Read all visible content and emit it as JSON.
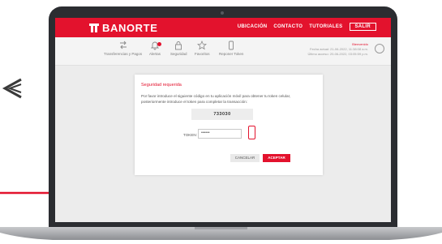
{
  "brand": {
    "name": "BANORTE",
    "color": "#e3122d"
  },
  "nav": {
    "items": [
      "UBICACIÓN",
      "CONTACTO",
      "TUTORIALES"
    ],
    "logout": "SALIR"
  },
  "toolbar": {
    "items": [
      {
        "label": "Transferencias y Pagos",
        "icon": "transfer-icon"
      },
      {
        "label": "Alertas",
        "icon": "bell-icon"
      },
      {
        "label": "Seguridad",
        "icon": "lock-icon"
      },
      {
        "label": "Favoritos",
        "icon": "star-icon"
      },
      {
        "label": "Reponer Token",
        "icon": "phone-icon"
      }
    ],
    "user": {
      "welcome": "Bienvenido",
      "current": "Fecha actual: 21-06-2022, 11:38:08 a.m.",
      "last": "Último acceso: 20-06-2022, 03:05:59 p.m."
    }
  },
  "dialog": {
    "title": "Seguridad requerida",
    "instructions": "Por favor introduce el siguiente código en tu aplicación móvil para obtener tu token celular, posteriormente introduce el token para completar la transacción:",
    "code": "733030",
    "token_label": "TOKEN:",
    "token_value": "••••••",
    "cancel": "CANCELAR",
    "accept": "ACEPTAR"
  },
  "colors": {
    "accent": "#e3122d",
    "frame": "#2b2d31"
  }
}
